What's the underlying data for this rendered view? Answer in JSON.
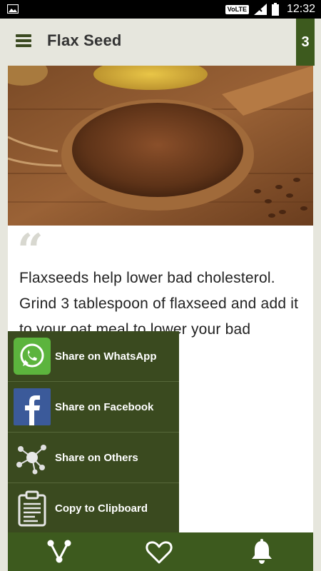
{
  "status_bar": {
    "network_label": "VoLTE",
    "time": "12:32"
  },
  "app_bar": {
    "title": "Flax Seed",
    "counter": "3"
  },
  "quote": {
    "text": "Flaxseeds help lower bad cholesterol. Grind 3 tablespoon of flaxseed and add it to your oat meal to lower your bad cholesterol."
  },
  "share_sheet": {
    "items": [
      {
        "label": "Share on WhatsApp",
        "icon": "whatsapp-icon"
      },
      {
        "label": "Share on Facebook",
        "icon": "facebook-icon"
      },
      {
        "label": "Share on Others",
        "icon": "share-network-icon"
      },
      {
        "label": "Copy to Clipboard",
        "icon": "clipboard-icon"
      }
    ]
  },
  "bottom_nav": {
    "items": [
      "share-icon",
      "heart-icon",
      "bell-icon"
    ]
  },
  "colors": {
    "primary": "#3d5a1e",
    "sheet": "#3a4a1f",
    "background": "#e6e6dd"
  }
}
